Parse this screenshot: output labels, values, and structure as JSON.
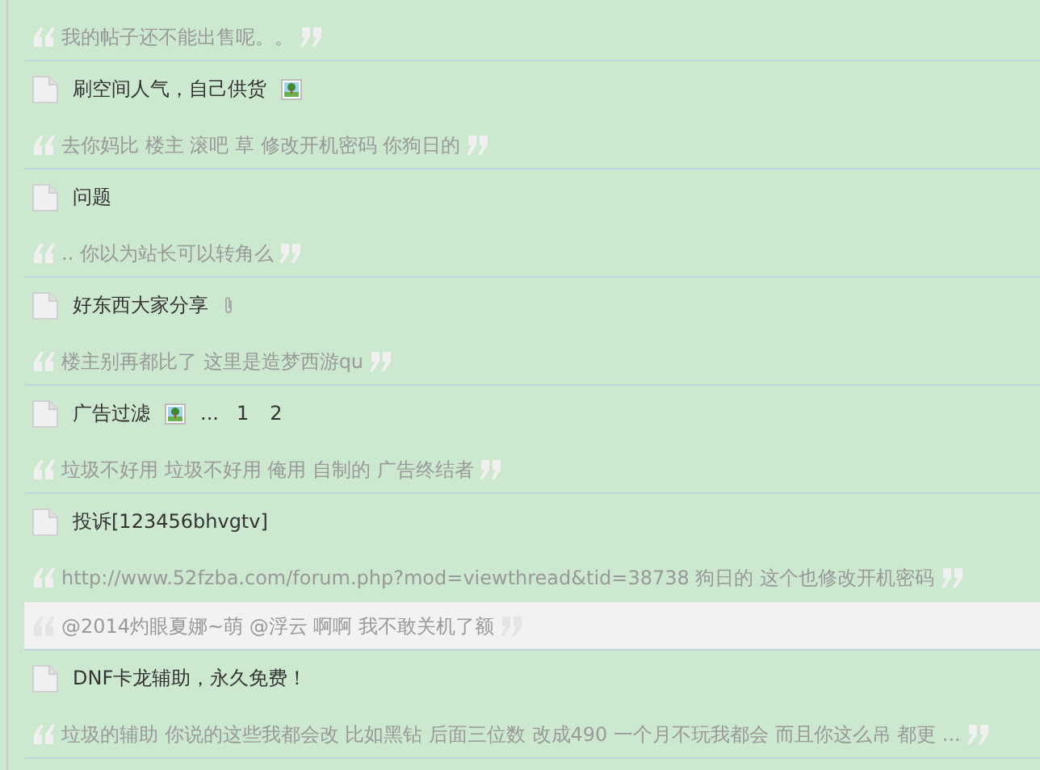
{
  "items": [
    {
      "kind": "quote",
      "text": "我的帖子还不能出售呢。。",
      "highlighted": false
    },
    {
      "kind": "thread",
      "title": "刷空间人气，自己供货",
      "icons": [
        {
          "kind": "image"
        }
      ]
    },
    {
      "kind": "quote",
      "text": "去你妈比 楼主 滚吧 草 修改开机密码 你狗日的",
      "highlighted": false
    },
    {
      "kind": "thread",
      "title": "问题"
    },
    {
      "kind": "quote",
      "text": ".. 你以为站长可以转角么",
      "highlighted": false
    },
    {
      "kind": "thread",
      "title": "好东西大家分享",
      "icons": [
        {
          "kind": "attachment"
        }
      ]
    },
    {
      "kind": "quote",
      "text": "楼主别再都比了 这里是造梦西游qu",
      "highlighted": false
    },
    {
      "kind": "thread",
      "title": "广告过滤",
      "icons": [
        {
          "kind": "image"
        }
      ],
      "pager": {
        "ellipsis": "...",
        "pages": [
          "1",
          "2"
        ]
      }
    },
    {
      "kind": "quote",
      "text": "垃圾不好用 垃圾不好用 俺用 自制的 广告终结者",
      "highlighted": false
    },
    {
      "kind": "thread",
      "title": "投诉[123456bhvgtv]"
    },
    {
      "kind": "quote",
      "text": "http://www.52fzba.com/forum.php?mod=viewthread&tid=38738 狗日的 这个也修改开机密码",
      "highlighted": false
    },
    {
      "kind": "quote",
      "text": "@2014灼眼夏娜~萌 @浮云 啊啊 我不敢关机了额",
      "highlighted": true
    },
    {
      "kind": "thread",
      "title": "DNF卡龙辅助，永久免费！"
    },
    {
      "kind": "quote",
      "text": "垃圾的辅助 你说的这些我都会改 比如黑钻 后面三位数 改成490 一个月不玩我都会 而且你这么吊 都更 ...",
      "highlighted": false
    }
  ]
}
